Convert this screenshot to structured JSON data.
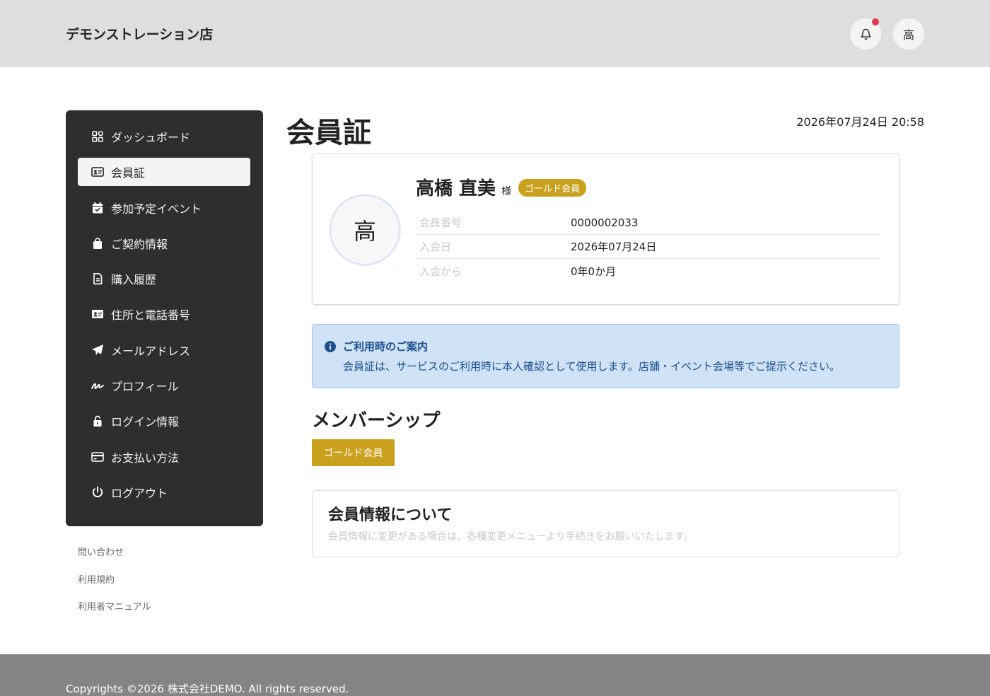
{
  "header": {
    "brand": "デモンストレーション店",
    "avatar_initial": "高"
  },
  "sidebar": {
    "items": [
      {
        "label": "ダッシュボード",
        "icon": "dashboard-icon"
      },
      {
        "label": "会員証",
        "icon": "id-card-icon",
        "active": true
      },
      {
        "label": "参加予定イベント",
        "icon": "calendar-check-icon"
      },
      {
        "label": "ご契約情報",
        "icon": "shopping-bag-icon"
      },
      {
        "label": "購入履歴",
        "icon": "document-icon"
      },
      {
        "label": "住所と電話番号",
        "icon": "address-card-icon"
      },
      {
        "label": "メールアドレス",
        "icon": "paper-plane-icon"
      },
      {
        "label": "プロフィール",
        "icon": "signature-icon"
      },
      {
        "label": "ログイン情報",
        "icon": "unlock-icon"
      },
      {
        "label": "お支払い方法",
        "icon": "credit-card-icon"
      },
      {
        "label": "ログアウト",
        "icon": "power-icon"
      }
    ],
    "links": [
      "問い合わせ",
      "利用規約",
      "利用者マニュアル"
    ]
  },
  "main": {
    "title": "会員証",
    "datetime": "2026年07月24日 20:58",
    "card": {
      "avatar_initial": "高",
      "name": "高橋 直美",
      "honorific": "様",
      "rank_badge": "ゴールド会員",
      "rows": [
        {
          "label": "会員番号",
          "value": "0000002033"
        },
        {
          "label": "入会日",
          "value": "2026年07月24日"
        },
        {
          "label": "入会から",
          "value": "0年0か月"
        }
      ]
    },
    "notice": {
      "title": "ご利用時のご案内",
      "body": "会員証は、サービスのご利用時に本人確認として使用します。店舗・イベント会場等でご提示ください。"
    },
    "membership": {
      "title": "メンバーシップ",
      "chip": "ゴールド会員"
    },
    "info_card": {
      "title": "会員情報について",
      "body": "会員情報に変更がある場合は、各種変更メニューより手続きをお願いいたします。"
    }
  },
  "footer": {
    "copyright": "Copyrights ©2026 株式会社DEMO. All rights reserved."
  },
  "colors": {
    "sidebar_bg": "#2f2e2d",
    "gold": "#caa11e",
    "notice_bg": "#cfe2f6",
    "notice_text": "#1d4f8f",
    "notification_dot": "#e0384f"
  }
}
